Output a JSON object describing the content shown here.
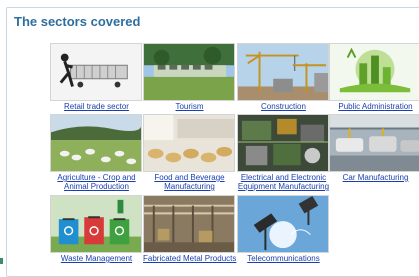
{
  "section": {
    "title": "The sectors covered"
  },
  "sectors": [
    {
      "id": "retail",
      "line1": "Retail trade sector",
      "line2": ""
    },
    {
      "id": "tourism",
      "line1": "Tourism",
      "line2": ""
    },
    {
      "id": "construction",
      "line1": "Construction",
      "line2": ""
    },
    {
      "id": "public-administration",
      "line1": "Public Administration",
      "line2": ""
    },
    {
      "id": "agriculture",
      "line1": "Agriculture - Crop and",
      "line2": "Animal Production"
    },
    {
      "id": "food-beverage",
      "line1": "Food and Beverage",
      "line2": "Manufacturing"
    },
    {
      "id": "electrical-electronic",
      "line1": "Electrical and Electronic",
      "line2": "Equipment Manufacturing"
    },
    {
      "id": "car-manufacturing",
      "line1": "Car Manufacturing",
      "line2": ""
    },
    {
      "id": "waste-management",
      "line1": "Waste Management",
      "line2": ""
    },
    {
      "id": "fabricated-metal",
      "line1": "Fabricated Metal Products",
      "line2": ""
    },
    {
      "id": "telecommunications",
      "line1": "Telecommunications",
      "line2": ""
    }
  ],
  "colors": {
    "title": "#2f6f9f",
    "link": "#1a3fb0",
    "frame_border": "#c9d6e3"
  },
  "icons": {
    "retail": "shopping-cart-icon",
    "tourism": "resort-sign-icon",
    "construction": "crane-icon",
    "public-administration": "green-city-icon",
    "agriculture": "sheep-field-icon",
    "food-beverage": "pastry-icon",
    "electrical-electronic": "circuit-board-icon",
    "car-manufacturing": "car-factory-icon",
    "waste-management": "recycling-bins-icon",
    "fabricated-metal": "factory-hall-icon",
    "telecommunications": "antenna-icon"
  }
}
